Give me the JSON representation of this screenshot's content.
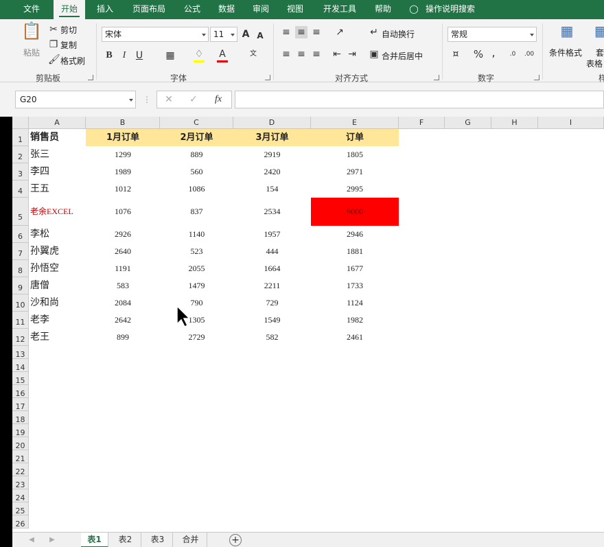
{
  "menu_tabs": [
    "文件",
    "开始",
    "插入",
    "页面布局",
    "公式",
    "数据",
    "审阅",
    "视图",
    "开发工具",
    "帮助"
  ],
  "search_label": "操作说明搜索",
  "clipboard": {
    "paste": "粘贴",
    "cut": "剪切",
    "copy": "复制",
    "format_painter": "格式刷",
    "group": "剪贴板"
  },
  "font": {
    "name": "宋体",
    "size": "11",
    "bold": "B",
    "italic": "I",
    "underline": "U",
    "group": "字体"
  },
  "alignment": {
    "wrap": "自动换行",
    "merge": "合并后居中",
    "group": "对齐方式"
  },
  "number": {
    "format": "常规",
    "percent": "%",
    "comma": ",",
    "group": "数字"
  },
  "styles": {
    "conditional": "条件格式",
    "table_format_1": "套",
    "table_format_2": "表格",
    "group_partial": "样"
  },
  "name_box": "G20",
  "fx": "fx",
  "columns": [
    "A",
    "B",
    "C",
    "D",
    "E",
    "F",
    "G",
    "H",
    "I"
  ],
  "rows": [
    "1",
    "2",
    "3",
    "4",
    "5",
    "6",
    "7",
    "8",
    "9",
    "10",
    "11",
    "12",
    "13",
    "14",
    "15",
    "16",
    "17",
    "18",
    "19",
    "20",
    "21",
    "22",
    "23",
    "24",
    "25",
    "26"
  ],
  "headers": [
    "销售员",
    "1月订单",
    "2月订单",
    "3月订单",
    "订单"
  ],
  "data": [
    [
      "张三",
      "1299",
      "889",
      "2919",
      "1805"
    ],
    [
      "李四",
      "1989",
      "560",
      "2420",
      "2971"
    ],
    [
      "王五",
      "1012",
      "1086",
      "154",
      "2995"
    ],
    [
      "老余EXCEL",
      "1076",
      "837",
      "2534",
      "9000"
    ],
    [
      "李松",
      "2926",
      "1140",
      "1957",
      "2946"
    ],
    [
      "孙翼虎",
      "2640",
      "523",
      "444",
      "1881"
    ],
    [
      "孙悟空",
      "1191",
      "2055",
      "1664",
      "1677"
    ],
    [
      "唐僧",
      "583",
      "1479",
      "2211",
      "1733"
    ],
    [
      "沙和尚",
      "2084",
      "790",
      "729",
      "1124"
    ],
    [
      "老李",
      "2642",
      "1305",
      "1549",
      "1982"
    ],
    [
      "老王",
      "899",
      "2729",
      "582",
      "2461"
    ]
  ],
  "sheets": [
    "表1",
    "表2",
    "表3",
    "合并"
  ],
  "colors": {
    "accent": "#217346",
    "header_fill": "#ffe699",
    "highlight": "#ff0000",
    "highlight_text": "#c00000"
  }
}
